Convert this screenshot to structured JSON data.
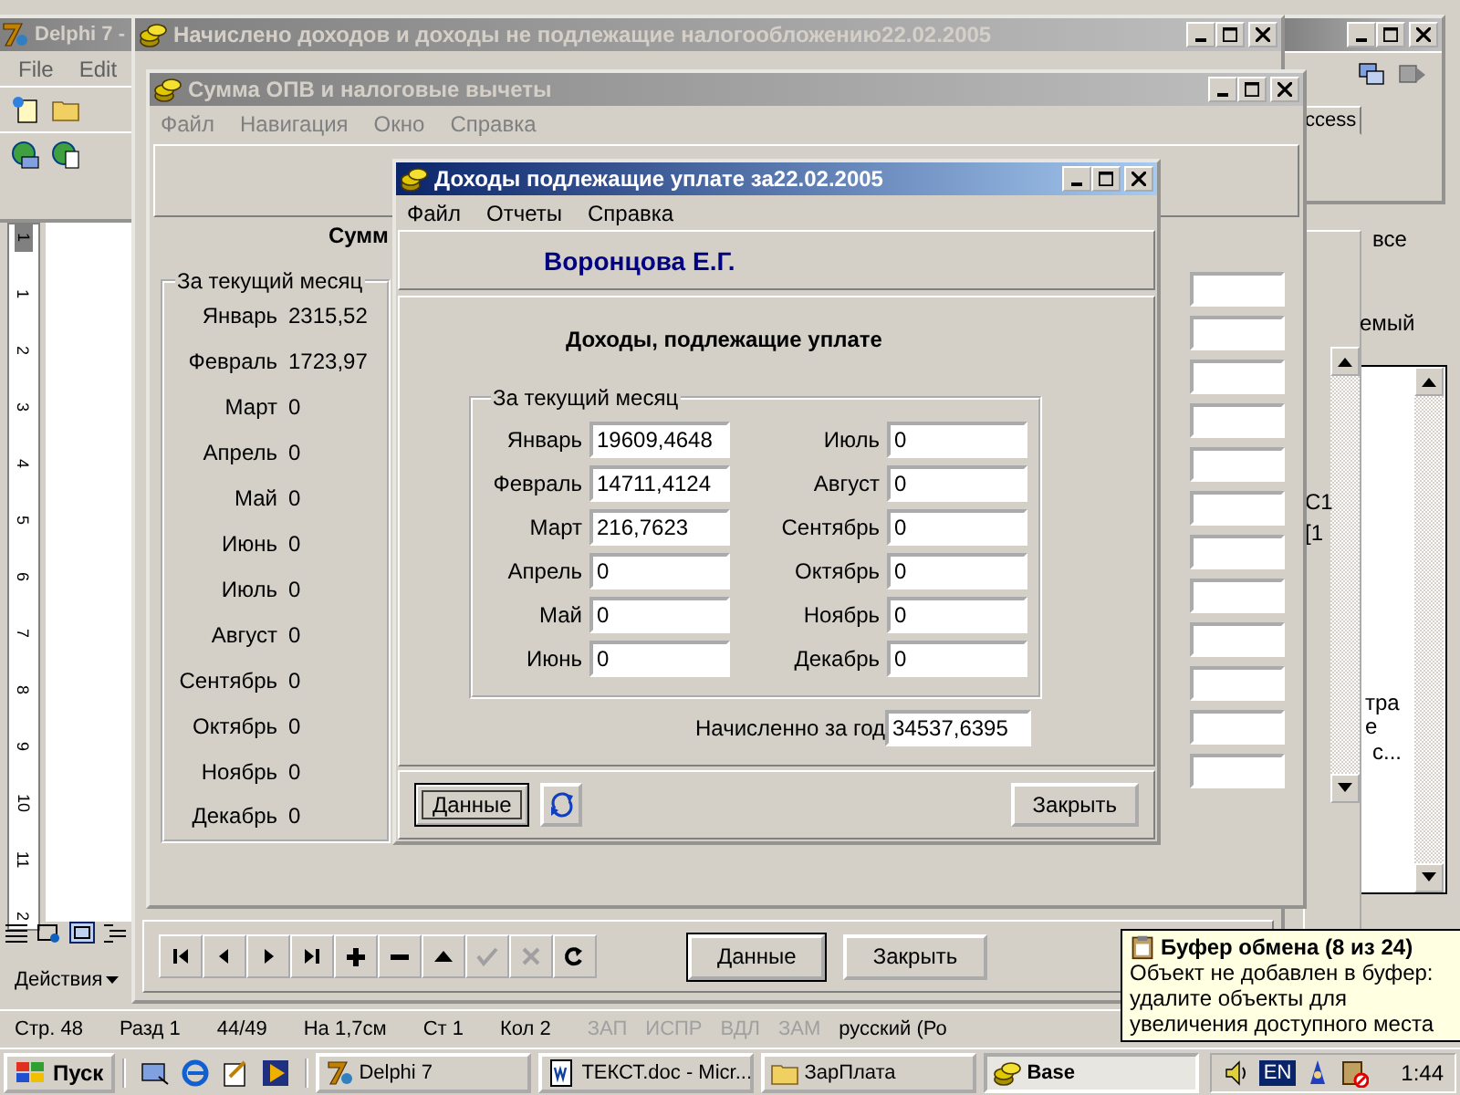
{
  "background_document": {
    "ruler_numbers": [
      "1",
      "1",
      "2",
      "3",
      "4",
      "5",
      "6",
      "7",
      "8",
      "9",
      "10",
      "11",
      "2"
    ],
    "actions_menu": "Действия",
    "status_bar": [
      {
        "text": "Стр. 48",
        "disabled": false
      },
      {
        "text": "Разд 1",
        "disabled": false
      },
      {
        "text": "44/49",
        "disabled": false
      },
      {
        "text": "На 1,7см",
        "disabled": false
      },
      {
        "text": "Ст 1",
        "disabled": false
      },
      {
        "text": "Кол 2",
        "disabled": false
      },
      {
        "text": "ЗАП",
        "disabled": true
      },
      {
        "text": "ИСПР",
        "disabled": true
      },
      {
        "text": "ВДЛ",
        "disabled": true
      },
      {
        "text": "ЗАМ",
        "disabled": true
      },
      {
        "text": "русский (Ро",
        "disabled": false
      }
    ],
    "task_pane_fragments": [
      "все",
      "емый",
      "С1",
      "[1",
      "тра",
      "е",
      "с..."
    ]
  },
  "delphi_window": {
    "title": "Delphi 7 -",
    "menu": [
      "File",
      "Edit"
    ]
  },
  "palette_window": {
    "tab": "ccess"
  },
  "accrued_window": {
    "title": "Начислено доходов и доходы не подлежащие налогообложению22.02.2005",
    "nav_buttons": [
      {
        "kind": "first",
        "disabled": false
      },
      {
        "kind": "prior",
        "disabled": false
      },
      {
        "kind": "next",
        "disabled": false
      },
      {
        "kind": "last",
        "disabled": false
      },
      {
        "kind": "insert",
        "disabled": false
      },
      {
        "kind": "delete",
        "disabled": false
      },
      {
        "kind": "edit",
        "disabled": false
      },
      {
        "kind": "post",
        "disabled": true
      },
      {
        "kind": "cancel",
        "disabled": true
      },
      {
        "kind": "refresh",
        "disabled": false
      }
    ],
    "buttons": [
      "Данные",
      "Закрыть"
    ]
  },
  "opv_window": {
    "title": "Сумма ОПВ и налоговые вычеты",
    "menu": [
      "Файл",
      "Навигация",
      "Окно",
      "Справка"
    ],
    "heading": "Сумм",
    "group_title": "За текущий месяц",
    "months": [
      {
        "label": "Январь",
        "value": "2315,52"
      },
      {
        "label": "Февраль",
        "value": "1723,97"
      },
      {
        "label": "Март",
        "value": "0"
      },
      {
        "label": "Апрель",
        "value": "0"
      },
      {
        "label": "Май",
        "value": "0"
      },
      {
        "label": "Июнь",
        "value": "0"
      },
      {
        "label": "Июль",
        "value": "0"
      },
      {
        "label": "Август",
        "value": "0"
      },
      {
        "label": "Сентябрь",
        "value": "0"
      },
      {
        "label": "Октябрь",
        "value": "0"
      },
      {
        "label": "Ноябрь",
        "value": "0"
      },
      {
        "label": "Декабрь",
        "value": "0"
      }
    ]
  },
  "dialog": {
    "title": "Доходы подлежащие уплате за22.02.2005",
    "menu": [
      "Файл",
      "Отчеты",
      "Справка"
    ],
    "person": "Воронцова Е.Г.",
    "heading": "Доходы, подлежащие уплате",
    "group_title": "За текущий месяц",
    "months": [
      {
        "label": "Январь",
        "value": "19609,4648"
      },
      {
        "label": "Февраль",
        "value": "14711,4124"
      },
      {
        "label": "Март",
        "value": "216,7623"
      },
      {
        "label": "Апрель",
        "value": "0"
      },
      {
        "label": "Май",
        "value": "0"
      },
      {
        "label": "Июнь",
        "value": "0"
      },
      {
        "label": "Июль",
        "value": "0"
      },
      {
        "label": "Август",
        "value": "0"
      },
      {
        "label": "Сентябрь",
        "value": "0"
      },
      {
        "label": "Октябрь",
        "value": "0"
      },
      {
        "label": "Ноябрь",
        "value": "0"
      },
      {
        "label": "Декабрь",
        "value": "0"
      }
    ],
    "total_label": "Начисленно за год",
    "total_value": "34537,6395",
    "data_button": "Данные",
    "close_button": "Закрыть"
  },
  "tooltip": {
    "title": "Буфер обмена (8 из 24)",
    "text": "Объект не добавлен в буфер: удалите объекты для увеличения доступного места"
  },
  "taskbar": {
    "start": "Пуск",
    "tasks": [
      {
        "kind": "delphi",
        "label": "Delphi 7",
        "selected": false
      },
      {
        "kind": "word",
        "label": "ТЕКСТ.doc - Micr...",
        "selected": false
      },
      {
        "kind": "folder",
        "label": "ЗарПлата",
        "selected": false
      },
      {
        "kind": "coins",
        "label": "Base",
        "selected": true
      }
    ],
    "language": "EN",
    "clock": "1:44"
  }
}
